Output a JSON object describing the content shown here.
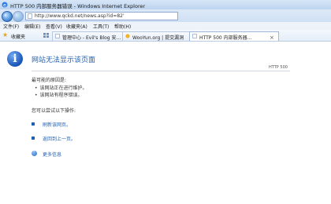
{
  "window": {
    "title": "HTTP 500 内部服务器错误 - Windows Internet Explorer"
  },
  "address_bar": {
    "url": "http://www.qckd.net/news.asp?id=82'"
  },
  "menu": {
    "items": [
      "文件(F)",
      "编辑(E)",
      "查看(V)",
      "收藏夹(A)",
      "工具(T)",
      "帮助(H)"
    ]
  },
  "favorites_bar": {
    "label": "收藏夹",
    "tabs": [
      {
        "label": "管理中心 - Evil's Blog 安..."
      },
      {
        "label": "WooYun.org | 提交漏洞"
      },
      {
        "label": "HTTP 500 内部服务器..."
      }
    ]
  },
  "error_page": {
    "title": "网站无法显示该页面",
    "status_code": "HTTP 500",
    "reasons_heading": "最可能的原因是:",
    "reasons": [
      "该网站正在进行维护。",
      "该网站有程序错误。"
    ],
    "actions_heading": "您可以尝试以下操作:",
    "actions": [
      {
        "label": "刷新该网页。"
      },
      {
        "label": "返回到上一页。"
      }
    ],
    "more_info": "更多信息"
  },
  "colors": {
    "accent": "#1e5fb4",
    "title_blue": "#1f5fae"
  }
}
